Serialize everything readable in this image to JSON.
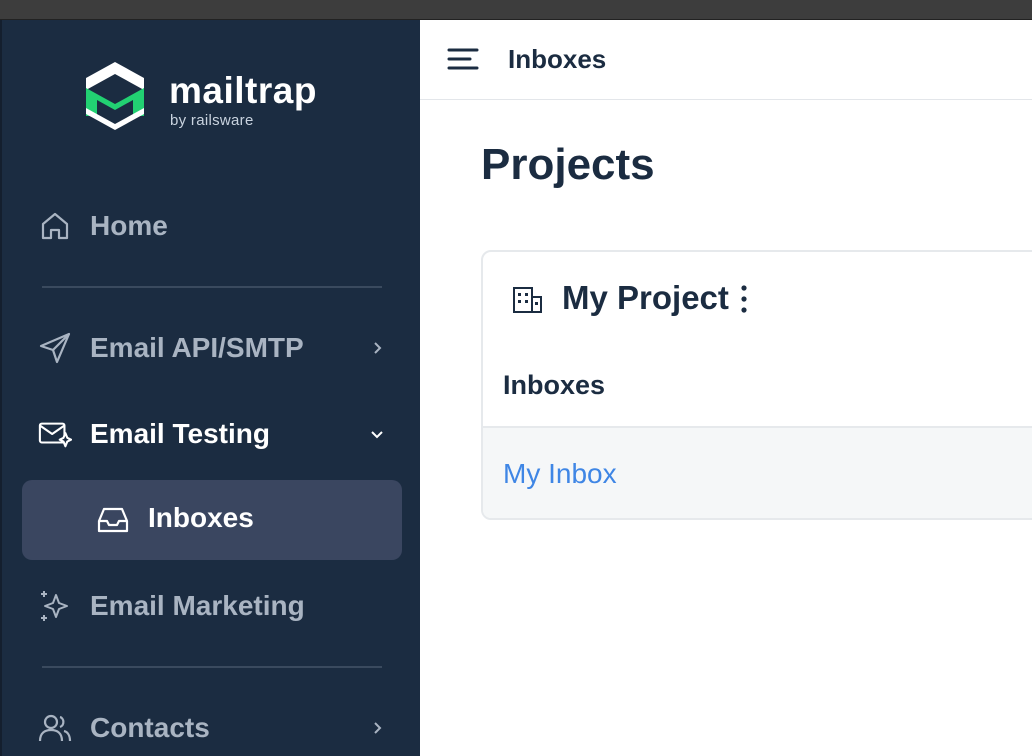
{
  "app": {
    "brand_name": "mailtrap",
    "brand_sub": "by railsware",
    "brand_color": "#22d172"
  },
  "sidebar": {
    "items": [
      {
        "label": "Home",
        "icon": "home-icon"
      },
      {
        "label": "Email API/SMTP",
        "icon": "send-icon"
      },
      {
        "label": "Email Testing",
        "icon": "email-testing-icon",
        "expanded": true
      },
      {
        "label": "Inboxes",
        "icon": "inbox-icon",
        "selected": true
      },
      {
        "label": "Email Marketing",
        "icon": "sparkle-icon"
      },
      {
        "label": "Contacts",
        "icon": "contacts-icon"
      }
    ]
  },
  "header": {
    "title": "Inboxes",
    "menu_icon": "hamburger-icon"
  },
  "main": {
    "title": "Projects",
    "project": {
      "name": "My Project",
      "icon": "building-icon",
      "section_label": "Inboxes",
      "inboxes": [
        {
          "name": "My Inbox"
        }
      ]
    }
  },
  "colors": {
    "sidebar_bg": "#1b2c41",
    "selected_bg": "#3a4660",
    "link": "#3f86e5",
    "heading": "#1b2c41"
  }
}
